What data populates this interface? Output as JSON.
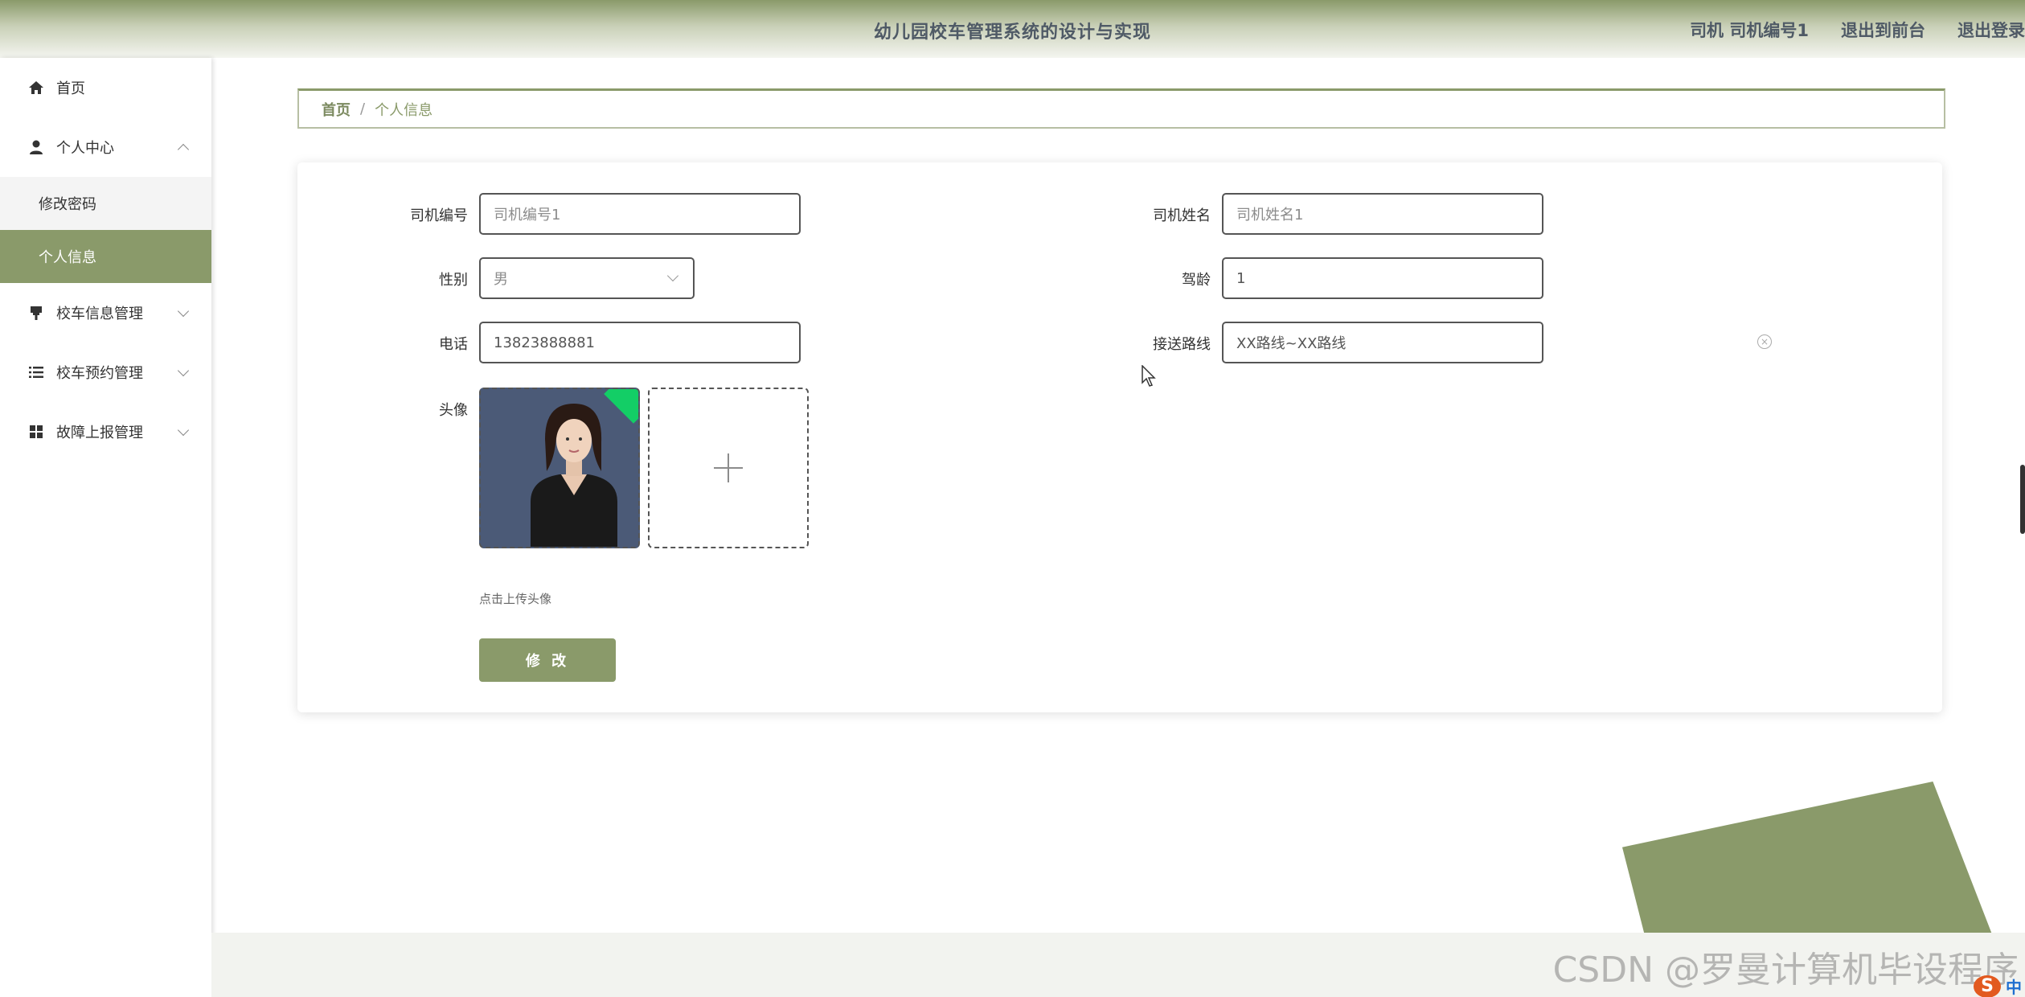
{
  "header": {
    "title": "幼儿园校车管理系统的设计与实现",
    "user_info": "司机 司机编号1",
    "exit_front": "退出到前台",
    "logout": "退出登录"
  },
  "sidebar": {
    "items": [
      {
        "label": "首页",
        "icon": "home-icon"
      },
      {
        "label": "个人中心",
        "icon": "user-icon",
        "expanded": true,
        "children": [
          {
            "label": "修改密码"
          },
          {
            "label": "个人信息",
            "active": true
          }
        ]
      },
      {
        "label": "校车信息管理",
        "icon": "bus-stop-icon"
      },
      {
        "label": "校车预约管理",
        "icon": "list-icon"
      },
      {
        "label": "故障上报管理",
        "icon": "grid-icon"
      }
    ]
  },
  "breadcrumb": {
    "home": "首页",
    "separator": "/",
    "current": "个人信息"
  },
  "form": {
    "driver_no": {
      "label": "司机编号",
      "value": "司机编号1"
    },
    "driver_name": {
      "label": "司机姓名",
      "value": "司机姓名1"
    },
    "gender": {
      "label": "性别",
      "value": "男"
    },
    "experience": {
      "label": "驾龄",
      "value": "1"
    },
    "phone": {
      "label": "电话",
      "value": "13823888881"
    },
    "route": {
      "label": "接送路线",
      "value": "XX路线~XX路线"
    },
    "avatar": {
      "label": "头像",
      "hint": "点击上传头像"
    },
    "submit_label": "修 改"
  },
  "colors": {
    "accent": "#8a9a6a",
    "success_corner": "#13ce66"
  },
  "watermark": "CSDN @罗曼计算机毕设程序",
  "tray": {
    "ime_logo": "S",
    "ime_mode": "中"
  }
}
